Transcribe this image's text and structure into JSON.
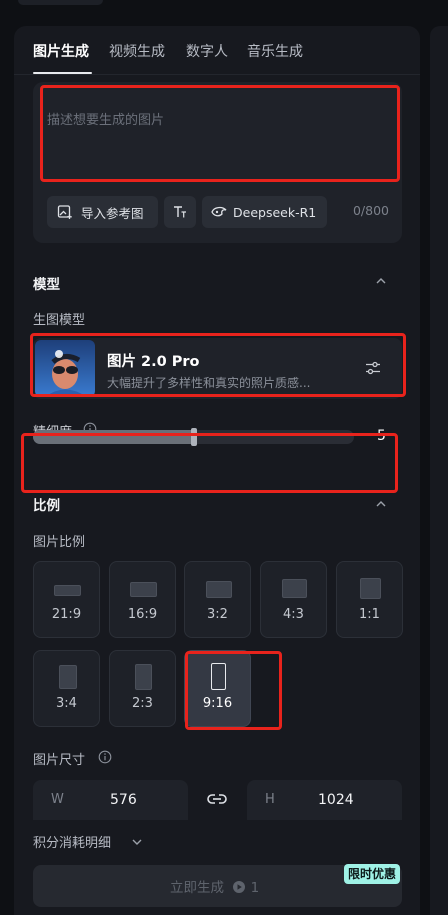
{
  "tabs": [
    {
      "label": "图片生成",
      "active": true
    },
    {
      "label": "视频生成",
      "active": false
    },
    {
      "label": "数字人",
      "active": false
    },
    {
      "label": "音乐生成",
      "active": false
    }
  ],
  "prompt": {
    "placeholder": "描述想要生成的图片",
    "import_label": "导入参考图",
    "model_pill_label": "Deepseek-R1",
    "counter": "0/800"
  },
  "model_section": {
    "title": "模型",
    "sublabel": "生图模型",
    "model_name": "图片 2.0 Pro",
    "model_desc": "大幅提升了多样性和真实的照片质感..."
  },
  "detail": {
    "label": "精细度",
    "value": "5",
    "level_fraction": 0.5
  },
  "ratio_section": {
    "title": "比例",
    "sublabel": "图片比例",
    "options": [
      {
        "label": "21:9",
        "selected": false
      },
      {
        "label": "16:9",
        "selected": false
      },
      {
        "label": "3:2",
        "selected": false
      },
      {
        "label": "4:3",
        "selected": false
      },
      {
        "label": "1:1",
        "selected": false
      },
      {
        "label": "3:4",
        "selected": false
      },
      {
        "label": "2:3",
        "selected": false
      },
      {
        "label": "9:16",
        "selected": true
      }
    ]
  },
  "size": {
    "label": "图片尺寸",
    "w_letter": "W",
    "width": "576",
    "h_letter": "H",
    "height": "1024"
  },
  "cost_label": "积分消耗明细",
  "generate": {
    "label": "立即生成",
    "cost": "1",
    "badge": "限时优惠"
  },
  "colors": {
    "accent_badge": "#9ff2e6",
    "highlight_box": "#e8231c"
  }
}
